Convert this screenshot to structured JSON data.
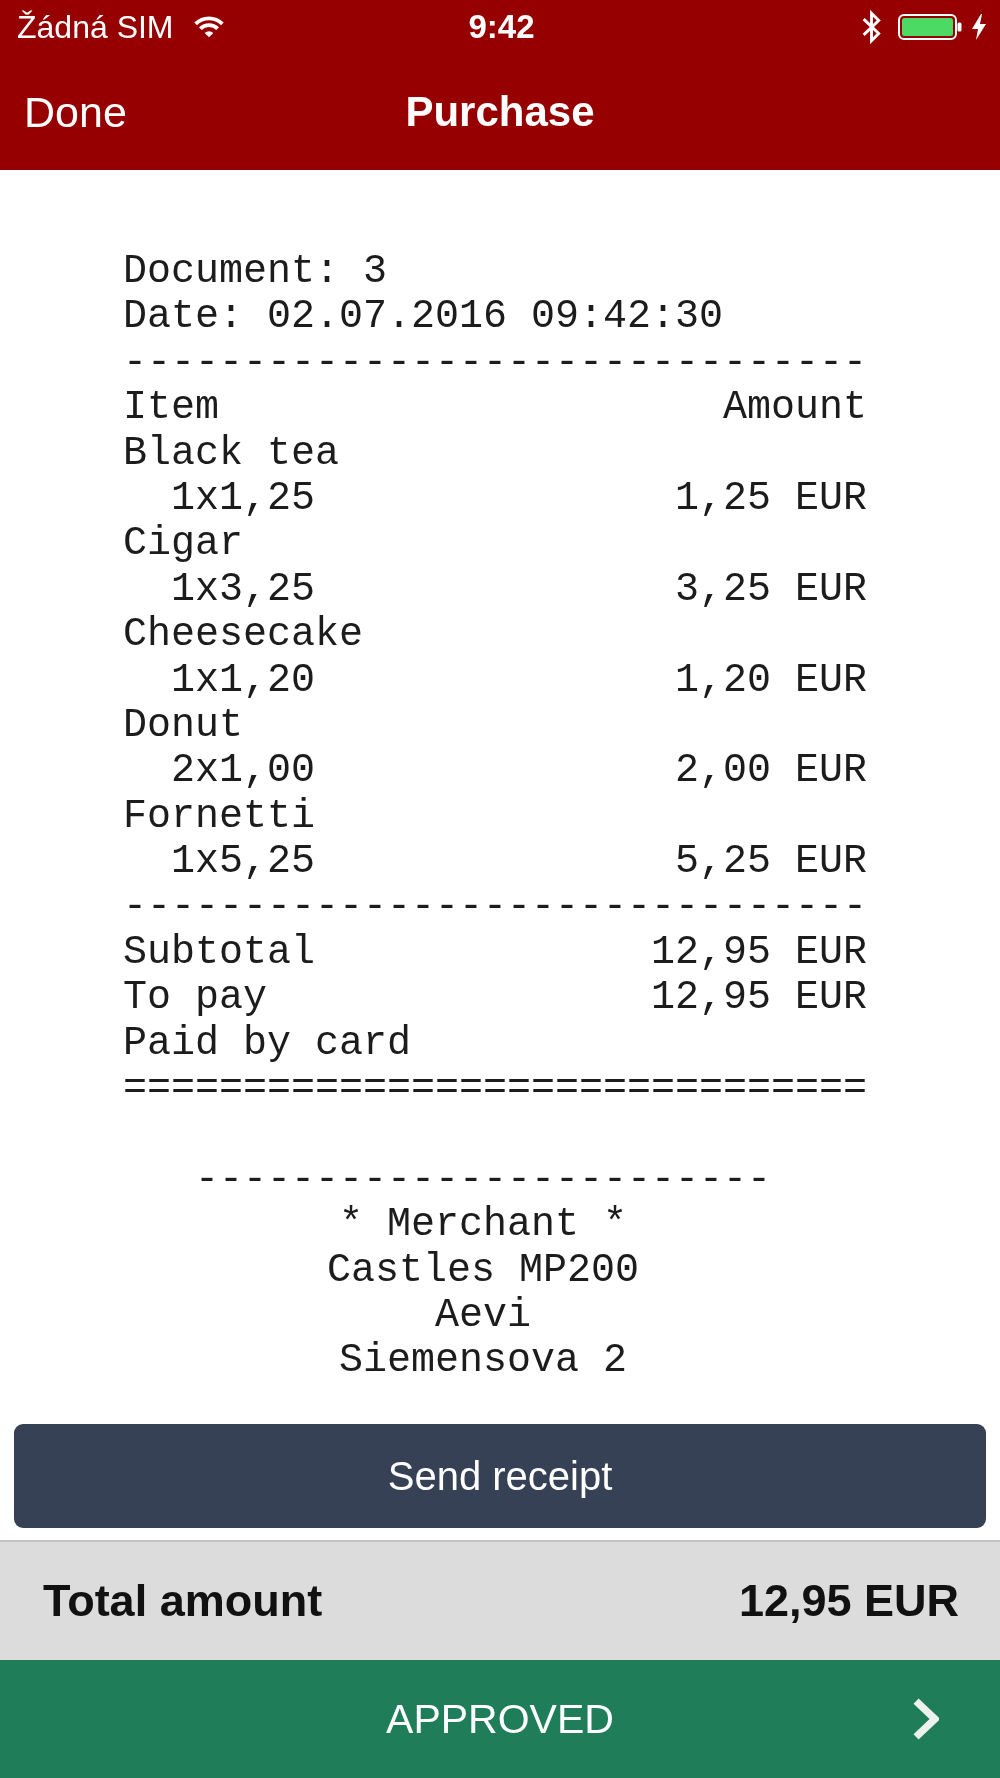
{
  "status_bar": {
    "carrier": "Žádná SIM",
    "time": "9:42"
  },
  "nav_bar": {
    "back_button": "Done",
    "title": "Purchase"
  },
  "receipt": {
    "lines": [
      {
        "kind": "text",
        "text": "Document: 3"
      },
      {
        "kind": "text",
        "text": "Date: 02.07.2016 09:42:30"
      },
      {
        "kind": "rule",
        "text": "-------------------------------"
      },
      {
        "kind": "heading",
        "left": "Item",
        "right": "Amount"
      },
      {
        "kind": "product",
        "text": "Black tea"
      },
      {
        "kind": "item",
        "left": "1x1,25",
        "right": "1,25 EUR"
      },
      {
        "kind": "product",
        "text": "Cigar"
      },
      {
        "kind": "item",
        "left": "1x3,25",
        "right": "3,25 EUR"
      },
      {
        "kind": "product",
        "text": "Cheesecake"
      },
      {
        "kind": "item",
        "left": "1x1,20",
        "right": "1,20 EUR"
      },
      {
        "kind": "product",
        "text": "Donut"
      },
      {
        "kind": "item",
        "left": "2x1,00",
        "right": "2,00 EUR"
      },
      {
        "kind": "product",
        "text": "Fornetti"
      },
      {
        "kind": "item",
        "left": "1x5,25",
        "right": "5,25 EUR"
      },
      {
        "kind": "rule",
        "text": "-------------------------------"
      },
      {
        "kind": "summary",
        "left": "Subtotal",
        "right": "12,95 EUR"
      },
      {
        "kind": "summary",
        "left": "To pay",
        "right": "12,95 EUR"
      },
      {
        "kind": "text",
        "text": "Paid by card"
      },
      {
        "kind": "rule",
        "text": "==============================="
      }
    ],
    "footer": {
      "rule": "------------------------",
      "lines": [
        "* Merchant *",
        "Castles MP200",
        "Aevi",
        "Siemensova 2"
      ]
    }
  },
  "send_button": {
    "label": "Send receipt"
  },
  "total": {
    "label": "Total amount",
    "value": "12,95 EUR"
  },
  "result_banner": {
    "label": "APPROVED"
  }
}
